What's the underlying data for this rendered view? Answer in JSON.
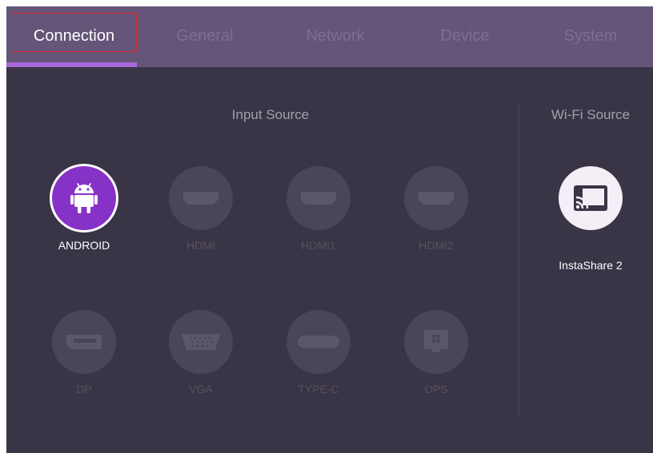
{
  "tabs": [
    {
      "label": "Connection",
      "active": true
    },
    {
      "label": "General",
      "active": false
    },
    {
      "label": "Network",
      "active": false
    },
    {
      "label": "Device",
      "active": false
    },
    {
      "label": "System",
      "active": false
    }
  ],
  "input_source": {
    "title": "Input Source",
    "items": [
      {
        "label": "ANDROID",
        "icon": "android-icon",
        "selected": true
      },
      {
        "label": "HDMI",
        "icon": "hdmi-icon",
        "selected": false
      },
      {
        "label": "HDMI1",
        "icon": "hdmi-icon",
        "selected": false
      },
      {
        "label": "HDMI2",
        "icon": "hdmi-icon",
        "selected": false
      },
      {
        "label": "DP",
        "icon": "displayport-icon",
        "selected": false
      },
      {
        "label": "VGA",
        "icon": "vga-icon",
        "selected": false
      },
      {
        "label": "TYPE-C",
        "icon": "usb-type-c-icon",
        "selected": false
      },
      {
        "label": "OPS",
        "icon": "ops-windows-icon",
        "selected": false
      }
    ]
  },
  "wifi_source": {
    "title": "Wi-Fi Source",
    "items": [
      {
        "label": "InstaShare 2",
        "icon": "cast-icon"
      }
    ]
  },
  "colors": {
    "background": "#393446",
    "tab_bar": "#655579",
    "accent": "#a867d6",
    "selected_source": "#8732c6",
    "highlight_box": "#e0282e"
  }
}
